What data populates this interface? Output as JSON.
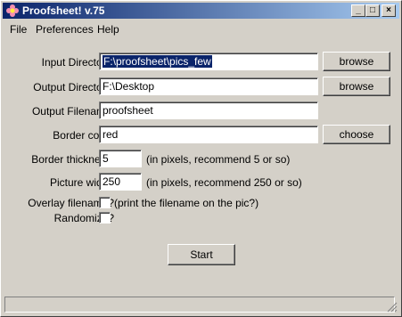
{
  "window": {
    "title": "Proofsheet! v.75",
    "icon": "flower-icon",
    "accent": "#0a246a"
  },
  "titlebar_buttons": {
    "minimize": "_",
    "maximize": "□",
    "close": "×"
  },
  "menu": [
    "File",
    "Preferences",
    "Help"
  ],
  "fields": {
    "input_dir": {
      "label": "Input Directory:",
      "value": "F:\\proofsheet\\pics_few",
      "button": "browse"
    },
    "output_dir": {
      "label": "Output Directory:",
      "value": "F:\\Desktop",
      "button": "browse"
    },
    "output_filename": {
      "label": "Output Filename:",
      "value": "proofsheet"
    },
    "border_color": {
      "label": "Border color:",
      "value": "red",
      "button": "choose"
    },
    "border_thickness": {
      "label": "Border thickness:",
      "value": "5",
      "hint": "(in pixels, recommend 5 or so)"
    },
    "picture_width": {
      "label": "Picture width:",
      "value": "250",
      "hint": "(in pixels, recommend 250 or so)"
    },
    "overlay_filename": {
      "label": "Overlay filename?",
      "hint": "(print the filename on the pic?)",
      "checked": false
    },
    "randomize": {
      "label": "Randomize?",
      "checked": false
    }
  },
  "start_button": "Start"
}
